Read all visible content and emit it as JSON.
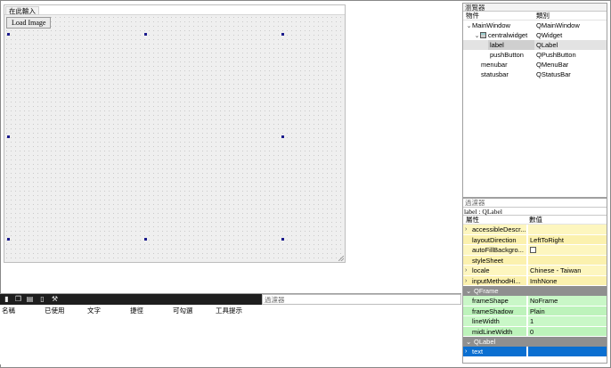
{
  "editor": {
    "menu_placeholder": "在此輸入",
    "button_label": "Load Image"
  },
  "object_inspector": {
    "title": "瀏覽器",
    "columns": {
      "object": "物件",
      "class": "類別"
    },
    "rows": [
      {
        "object": "MainWindow",
        "class": "QMainWindow",
        "expander": "⌄"
      },
      {
        "object": "centralwidget",
        "class": "QWidget",
        "expander": "⌄"
      },
      {
        "object": "label",
        "class": "QLabel"
      },
      {
        "object": "pushButton",
        "class": "QPushButton"
      },
      {
        "object": "menubar",
        "class": "QMenuBar"
      },
      {
        "object": "statusbar",
        "class": "QStatusBar"
      }
    ]
  },
  "property_editor": {
    "filter_placeholder": "過濾器",
    "object_label": "label : QLabel",
    "columns": {
      "property": "屬性",
      "value": "數值"
    },
    "rows_a": [
      {
        "name": "accessibleDescr...",
        "value": "",
        "arrow": "›"
      },
      {
        "name": "layoutDirection",
        "value": "LeftToRight",
        "arrow": ""
      },
      {
        "name": "autoFillBackgro...",
        "value": "",
        "arrow": ""
      },
      {
        "name": "styleSheet",
        "value": "",
        "arrow": ""
      },
      {
        "name": "locale",
        "value": "Chinese - Taiwan",
        "arrow": "›"
      },
      {
        "name": "inputMethodHi...",
        "value": "ImhNone",
        "arrow": "›"
      }
    ],
    "category_qframe": "QFrame",
    "rows_b": [
      {
        "name": "frameShape",
        "value": "NoFrame"
      },
      {
        "name": "frameShadow",
        "value": "Plain"
      },
      {
        "name": "lineWidth",
        "value": "1"
      },
      {
        "name": "midLineWidth",
        "value": "0"
      }
    ],
    "category_qlabel": "QLabel",
    "selected_row": {
      "name": "text",
      "value": "",
      "arrow": "›"
    },
    "autofill_checked": false
  },
  "action_editor": {
    "filter_placeholder": "過濾器",
    "columns": [
      "名稱",
      "已使用",
      "文字",
      "捷徑",
      "可勾選",
      "工具提示"
    ],
    "toolbar_icons": [
      "new-action-icon",
      "copy-icon",
      "paste-icon",
      "delete-icon",
      "configure-icon"
    ]
  },
  "colors": {
    "selection": "#0a6fd1",
    "object_props": "#fdf6bf",
    "frame_props": "#c9f7c7",
    "category": "#8f8f8f",
    "handle": "#1b1b8c"
  }
}
